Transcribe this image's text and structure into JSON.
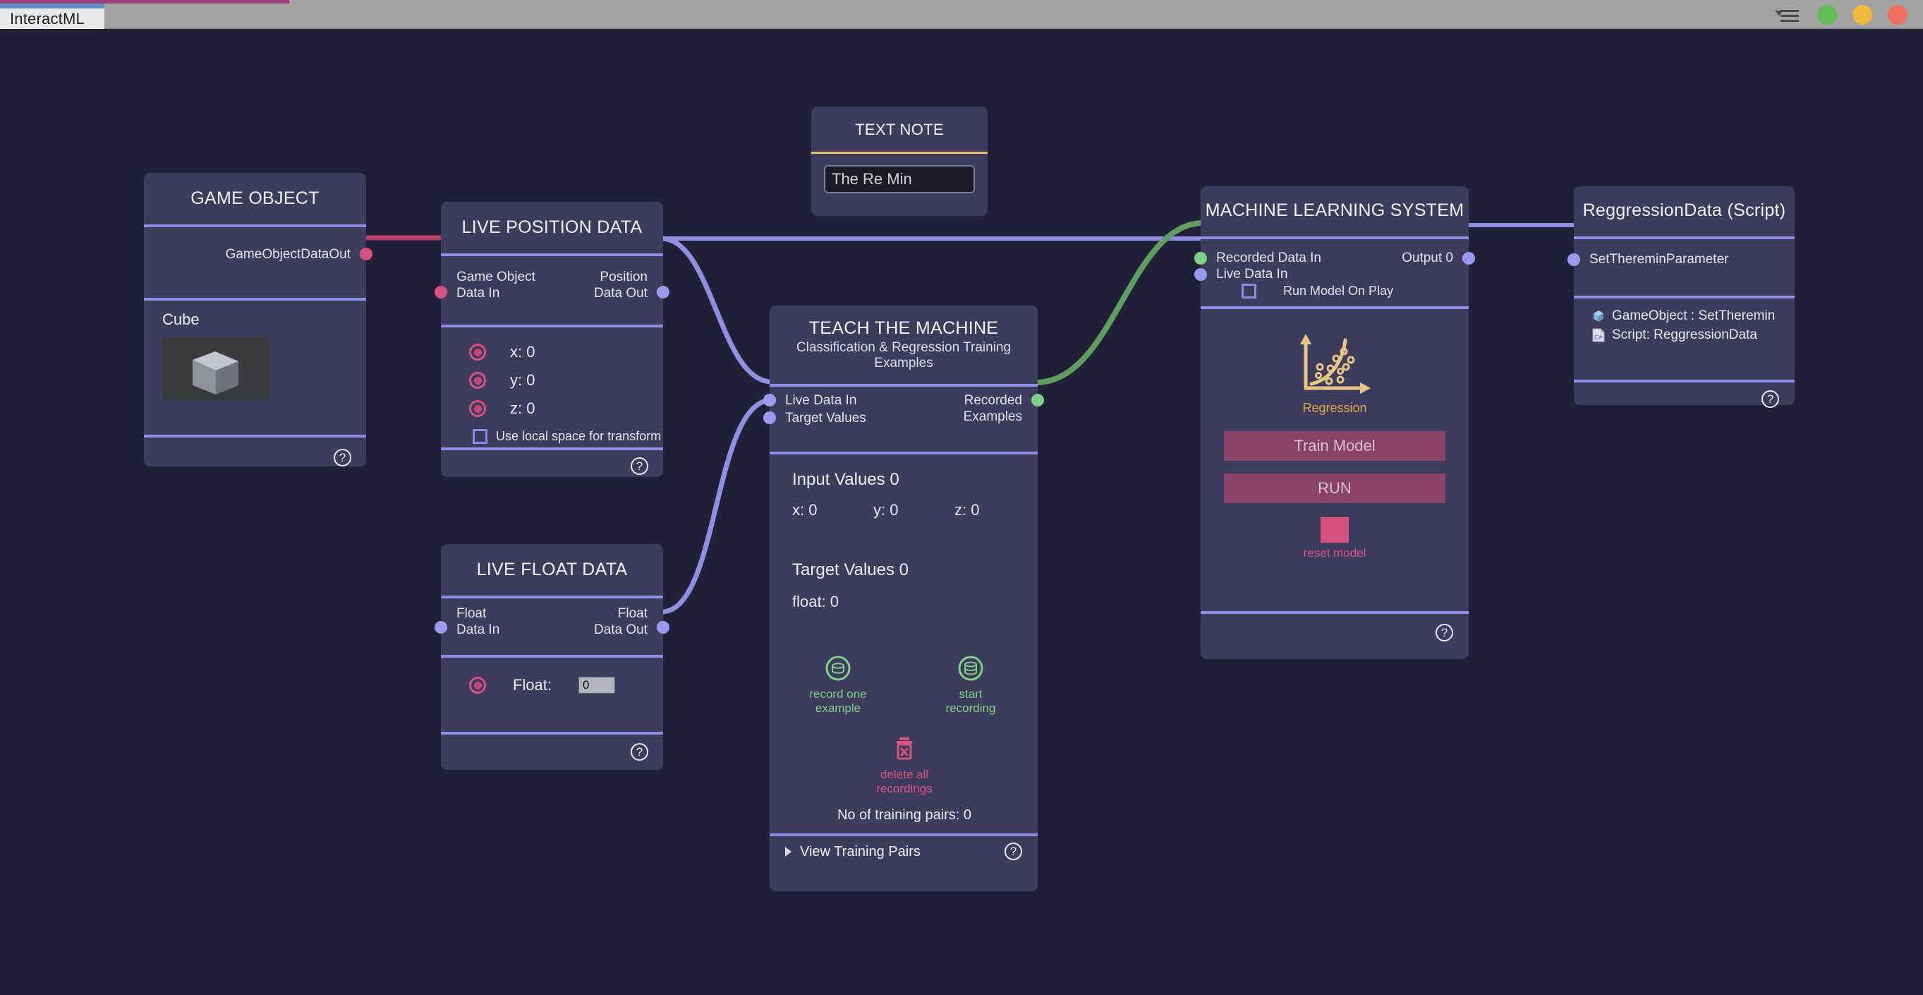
{
  "window": {
    "tab_label": "InteractML",
    "controls": [
      {
        "name": "menu-icon",
        "icon": "hamburger-menu-icon"
      },
      {
        "name": "window-button-green",
        "color": "#62bd54"
      },
      {
        "name": "window-button-yellow",
        "color": "#f0bb3c"
      },
      {
        "name": "window-button-red",
        "color": "#ef6f61"
      }
    ]
  },
  "colors": {
    "canvas_bg": "#212038",
    "node_bg": "#3d3c5c",
    "divider_blue": "#8e8ee8",
    "divider_gold": "#e8c06a",
    "port_blue": "#9a9aee",
    "port_pink": "#d6537f",
    "port_green": "#7fd187",
    "button_magenta": "#8a4268",
    "accent_gold": "#e0a84a"
  },
  "nodes": {
    "game_object": {
      "title": "GAME OBJECT",
      "out_port_label": "GameObjectDataOut",
      "body_label": "Cube",
      "help": "?"
    },
    "live_position_data": {
      "title": "LIVE POSITION DATA",
      "in_port_label": "Game Object\nData In",
      "in_port_line1": "Game Object",
      "in_port_line2": "Data In",
      "out_port_line1": "Position",
      "out_port_line2": "Data Out",
      "values": [
        "x: 0",
        "y: 0",
        "z: 0"
      ],
      "checkbox_label": "Use local space for transform",
      "checkbox_checked": false,
      "help": "?"
    },
    "live_float_data": {
      "title": "LIVE FLOAT DATA",
      "in_port_line1": "Float",
      "in_port_line2": "Data In",
      "out_port_line1": "Float",
      "out_port_line2": "Data Out",
      "field_label": "Float:",
      "field_value": "0",
      "help": "?"
    },
    "text_note": {
      "title": "TEXT NOTE",
      "note_value": "The Re Min"
    },
    "teach_the_machine": {
      "title": "TEACH THE MACHINE",
      "subtitle": "Classification & Regression Training Examples",
      "in_port_1": "Live Data In",
      "in_port_2": "Target Values",
      "out_port_line1": "Recorded",
      "out_port_line2": "Examples",
      "input_values_header": "Input Values 0",
      "input_x": "x: 0",
      "input_y": "y: 0",
      "input_z": "z: 0",
      "target_values_header": "Target Values 0",
      "target_float": "float: 0",
      "record_one_line1": "record one",
      "record_one_line2": "example",
      "start_rec_line1": "start",
      "start_rec_line2": "recording",
      "delete_line1": "delete all",
      "delete_line2": "recordings",
      "training_pairs": "No of training pairs: 0",
      "footer_label": "View Training Pairs",
      "help": "?"
    },
    "machine_learning_system": {
      "title": "MACHINE LEARNING SYSTEM",
      "in_port_1": "Recorded Data In",
      "in_port_2": "Live Data In",
      "checkbox_label": "Run Model On Play",
      "checkbox_checked": false,
      "out_port_label": "Output 0",
      "graphic_label": "Regression",
      "train_button": "Train Model",
      "run_button": "RUN",
      "reset_label": "reset model",
      "help": "?"
    },
    "regression_data": {
      "title": "ReggressionData (Script)",
      "in_port_label": "SetThereminParameter",
      "row_gameobject": "GameObject : SetTheremin",
      "row_script": "Script: ReggressionData",
      "help": "?"
    }
  }
}
